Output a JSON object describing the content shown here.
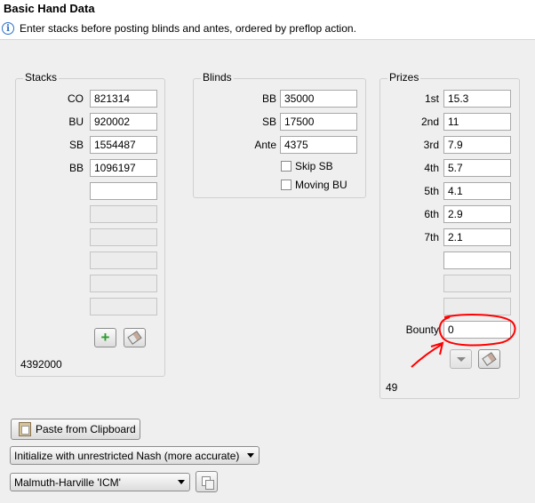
{
  "header": {
    "title": "Basic Hand Data",
    "info_text": "Enter stacks before posting blinds and antes, ordered by preflop action."
  },
  "stacks": {
    "label": "Stacks",
    "rows": [
      {
        "label": "CO",
        "value": "821314"
      },
      {
        "label": "BU",
        "value": "920002"
      },
      {
        "label": "SB",
        "value": "1554487"
      },
      {
        "label": "BB",
        "value": "1096197"
      }
    ],
    "total": "4392000"
  },
  "blinds": {
    "label": "Blinds",
    "rows": [
      {
        "label": "BB",
        "value": "35000"
      },
      {
        "label": "SB",
        "value": "17500"
      },
      {
        "label": "Ante",
        "value": "4375"
      }
    ],
    "skip_sb_label": "Skip SB",
    "moving_bu_label": "Moving BU"
  },
  "prizes": {
    "label": "Prizes",
    "rows": [
      {
        "label": "1st",
        "value": "15.3"
      },
      {
        "label": "2nd",
        "value": "11"
      },
      {
        "label": "3rd",
        "value": "7.9"
      },
      {
        "label": "4th",
        "value": "5.7"
      },
      {
        "label": "5th",
        "value": "4.1"
      },
      {
        "label": "6th",
        "value": "2.9"
      },
      {
        "label": "7th",
        "value": "2.1"
      }
    ],
    "bounty_label": "Bounty",
    "bounty_value": "0",
    "total": "49"
  },
  "bottom": {
    "paste_label": "Paste from Clipboard",
    "init_select": "Initialize with unrestricted Nash (more accurate)",
    "model_select": "Malmuth-Harville 'ICM'"
  },
  "annotation_color": "#ff0000"
}
